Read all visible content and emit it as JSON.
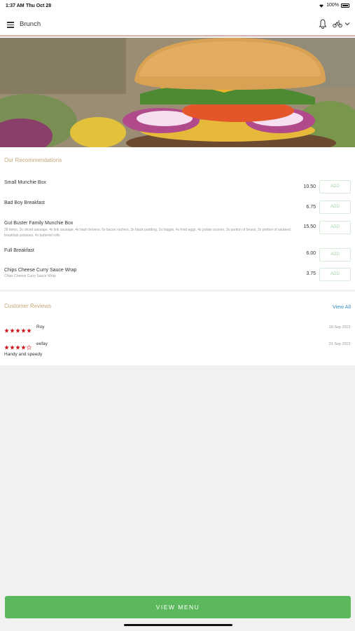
{
  "status_bar": {
    "time": "1:37 AM",
    "date": "Thu Oct 28",
    "battery": "100%"
  },
  "header": {
    "title": "Brunch"
  },
  "recommendations": {
    "title": "Our Recommendations",
    "add_label": "ADD",
    "items": [
      {
        "name": "Small Munchie Box",
        "description": "",
        "price": "10.50"
      },
      {
        "name": "Bad Boy Breakfast",
        "description": "",
        "price": "6.75"
      },
      {
        "name": "Gut Buster Family Munchie Box",
        "description": "39 items, 3x sliced sausage, 4x link sausage, 4x hash browns, 6x bacon rashers, 3x black pudding, 2x haggis, 4x fried eggs, 4x potato scones, 3x portion of beans, 2x portion of sauteed breakfast potatoes, 4x buttered rolls",
        "price": "15.50"
      },
      {
        "name": "Full Breakfast",
        "description": "",
        "price": "6.00"
      },
      {
        "name": "Chips Cheese Curry Sauce Wrap",
        "description": "Chips Cheese Curry Sauce Wrap",
        "price": "3.75"
      }
    ]
  },
  "reviews": {
    "title": "Customer Reviews",
    "view_all": "View All",
    "items": [
      {
        "name": "Roy",
        "rating": 5,
        "date": "18 Sep 2021",
        "text": ""
      },
      {
        "name": "eefay",
        "rating": 4,
        "date": "01 Sep 2021",
        "text": "Handy and speedy"
      }
    ]
  },
  "footer": {
    "view_menu": "VIEW MENU"
  },
  "colors": {
    "accent_green": "#5cb85c",
    "section_title": "#c3a879",
    "link_blue": "#3b8bc4",
    "star_red": "#d0191e",
    "header_border": "#d9b3ad"
  }
}
